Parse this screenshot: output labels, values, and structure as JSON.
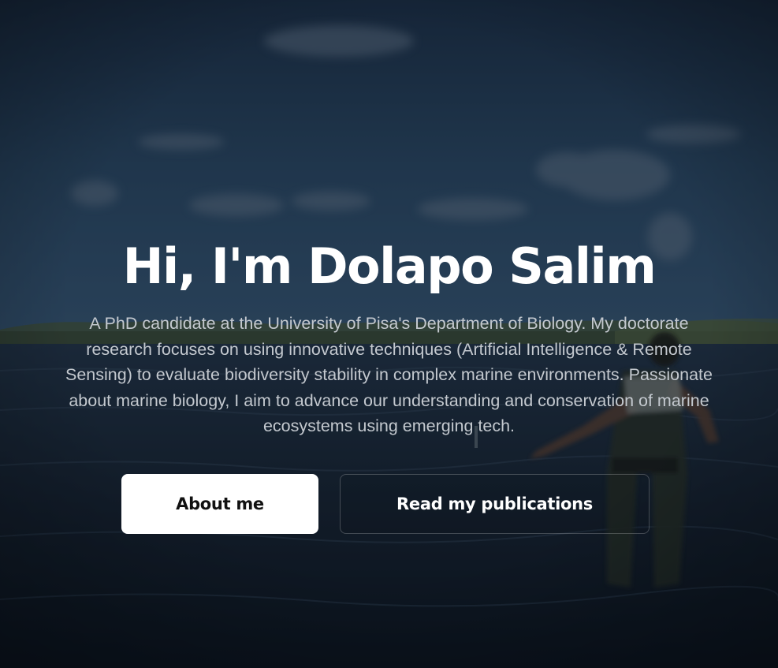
{
  "hero": {
    "title": "Hi, I'm Dolapo Salim",
    "bio": "A PhD candidate at the University of Pisa's Department of Biology. My doctorate research focuses on using innovative techniques (Artificial Intelligence & Remote Sensing) to evaluate biodiversity stability in complex marine environments. Passionate about marine biology, I aim to advance our understanding and conservation of marine ecosystems using emerging tech.",
    "buttons": {
      "about_label": "About me",
      "publications_label": "Read my publications"
    }
  },
  "colors": {
    "title_text": "#ffffff",
    "bio_text": "#c4c9cf",
    "primary_button_bg": "#ffffff",
    "primary_button_text": "#111111"
  }
}
